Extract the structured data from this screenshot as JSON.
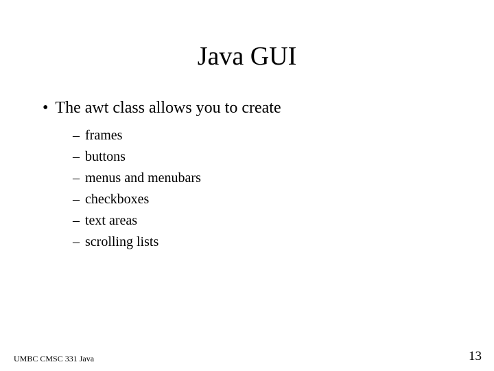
{
  "slide": {
    "title": "Java GUI",
    "bullet": {
      "text": "The awt class allows you to create",
      "subitems": [
        "frames",
        "buttons",
        "menus and menubars",
        "checkboxes",
        "text areas",
        "scrolling lists"
      ]
    }
  },
  "footer": {
    "left": "UMBC CMSC 331 Java",
    "page": "13"
  }
}
